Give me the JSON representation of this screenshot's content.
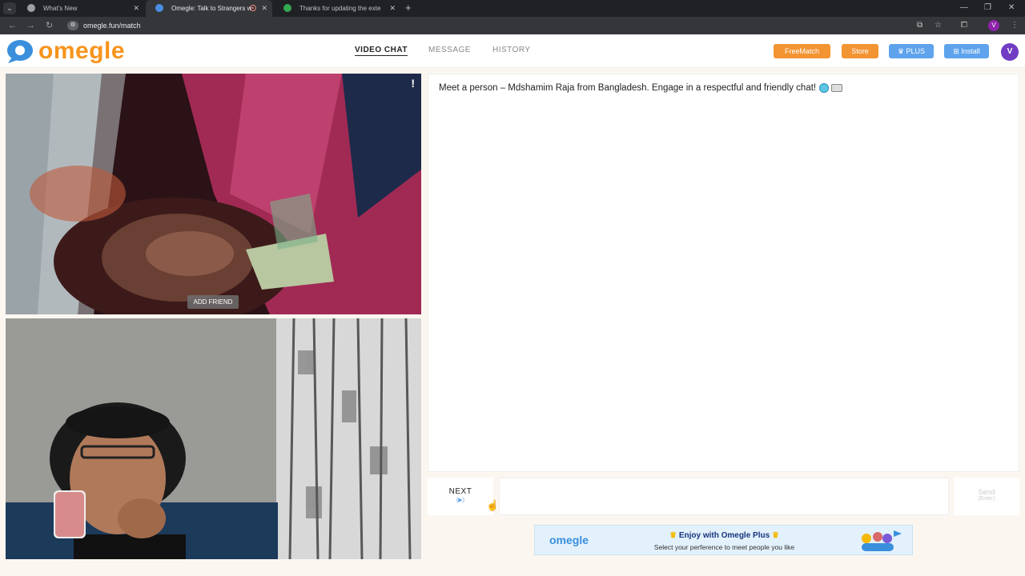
{
  "browser": {
    "tabs": [
      {
        "title": "What's New"
      },
      {
        "title": "Omegle: Talk to Strangers w"
      },
      {
        "title": "Thanks for updating the exte"
      }
    ],
    "url": "omegle.fun/match"
  },
  "header": {
    "logo_text": "omegle",
    "nav": [
      "VIDEO CHAT",
      "MESSAGE",
      "HISTORY"
    ],
    "buttons": {
      "freematch": "FreeMatch",
      "store": "Store",
      "plus": "PLUS",
      "install": "Install"
    },
    "avatar_letter": "V"
  },
  "video": {
    "add_friend": "ADD FRIEND",
    "report": "!"
  },
  "chat": {
    "message": "Meet a person – Mdshamim Raja from Bangladesh. Engage in a respectful and friendly chat!"
  },
  "controls": {
    "next_label": "NEXT",
    "next_hint": "(▶)",
    "send_label": "Send",
    "send_hint": "(Enter)"
  },
  "banner": {
    "logo": "omegle",
    "title": "Enjoy with Omegle Plus",
    "subtitle": "Select your perference to meet people you like"
  },
  "colors": {
    "brand_orange": "#f7941d",
    "button_orange": "#f39432",
    "button_blue": "#5ea3ec",
    "avatar_purple": "#6f3cc3"
  }
}
